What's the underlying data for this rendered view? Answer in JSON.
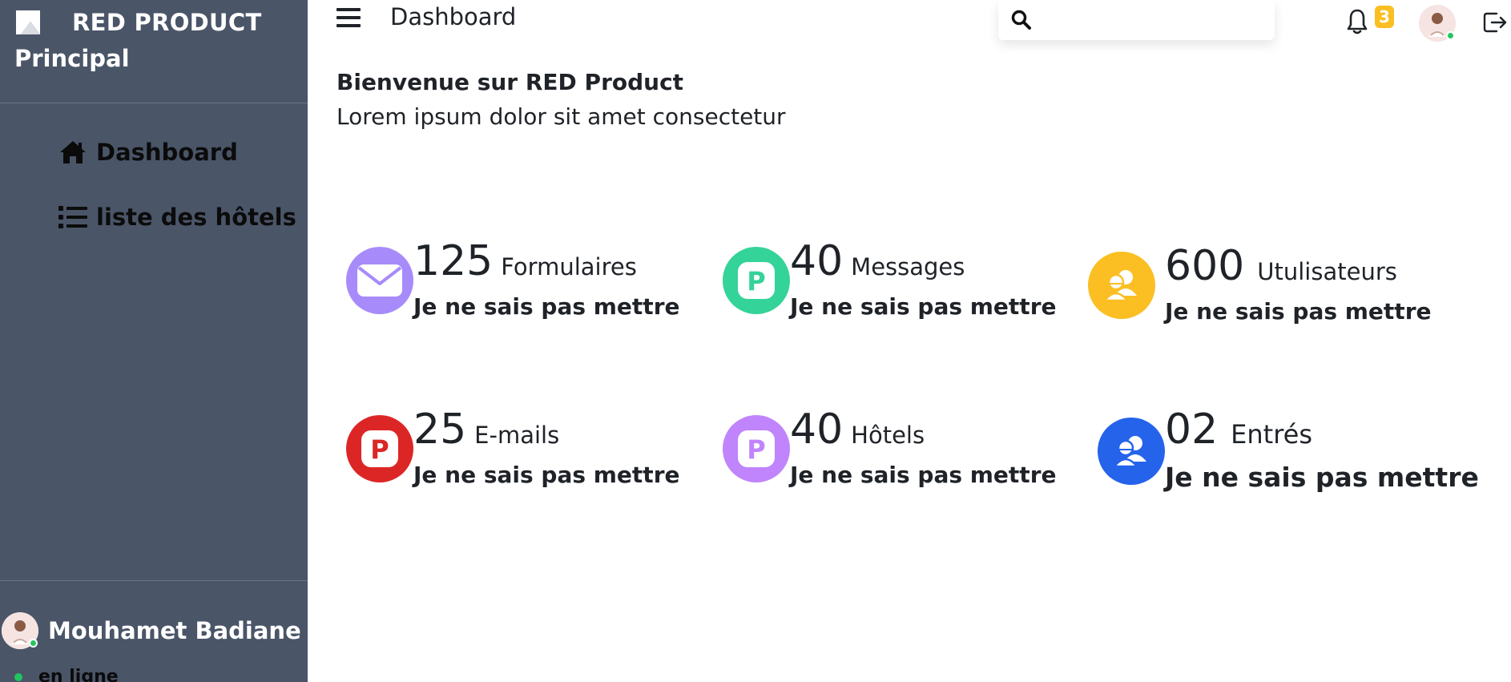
{
  "sidebar": {
    "brand": "RED PRODUCT",
    "section": "Principal",
    "items": [
      {
        "label": "Dashboard",
        "icon": "home-icon"
      },
      {
        "label": "liste des hôtels",
        "icon": "list-icon"
      }
    ],
    "user": {
      "name": "Mouhamet Badiane",
      "status": "en ligne"
    }
  },
  "topbar": {
    "title": "Dashboard",
    "search_placeholder": "",
    "notification_count": "3"
  },
  "welcome": {
    "title": "Bienvenue sur RED Product",
    "subtitle": "Lorem ipsum dolor sit amet consectetur"
  },
  "stats": [
    {
      "value": "125",
      "label": "Formulaires",
      "desc": "Je ne sais pas mettre",
      "color": "#a78bfa",
      "icon": "envelope-icon"
    },
    {
      "value": "40",
      "label": "Messages",
      "desc": "Je ne sais pas mettre",
      "color": "#34d399",
      "icon": "p-icon"
    },
    {
      "value": "600",
      "label": "Utulisateurs",
      "desc": "Je ne sais pas mettre",
      "color": "#fbbf24",
      "icon": "users-icon"
    },
    {
      "value": "25",
      "label": "E-mails",
      "desc": "Je ne sais pas mettre",
      "color": "#dc2626",
      "icon": "p-icon"
    },
    {
      "value": "40",
      "label": "Hôtels",
      "desc": "Je ne sais pas mettre",
      "color": "#c084fc",
      "icon": "p-icon"
    },
    {
      "value": "02",
      "label": "Entrés",
      "desc": "Je ne sais pas mettre",
      "color": "#2563eb",
      "icon": "users-icon"
    }
  ]
}
